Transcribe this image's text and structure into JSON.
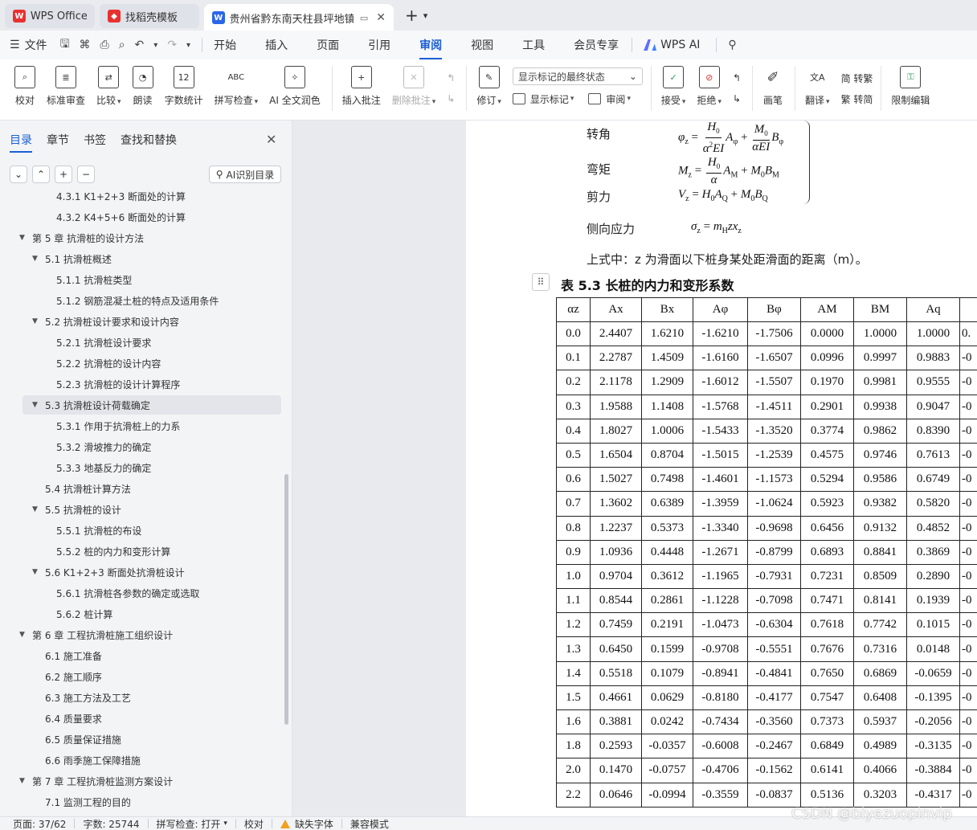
{
  "tabs": [
    {
      "label": "WPS Office",
      "icon": "wps-logo-icon",
      "color": "#e8312f"
    },
    {
      "label": "找稻壳模板",
      "icon": "docer-icon",
      "color": "#e8312f"
    },
    {
      "label": "贵州省黔东南天柱县坪地镇某",
      "icon": "word-doc-icon",
      "color": "#2b66e8"
    }
  ],
  "menubar": {
    "file": "文件",
    "tabs": [
      "开始",
      "插入",
      "页面",
      "引用",
      "审阅",
      "视图",
      "工具",
      "会员专享"
    ],
    "active_tab": "审阅",
    "wps_ai": "WPS AI"
  },
  "ribbon": {
    "proofread": "校对",
    "std_review": "标准审查",
    "compare": "比较",
    "read_aloud": "朗读",
    "word_count": "字数统计",
    "spell_check": "拼写检查",
    "ai_polish": "AI 全文润色",
    "insert_comment": "插入批注",
    "delete_comment": "删除批注",
    "track": "修订",
    "markup_select": "显示标记的最终状态",
    "show_markup": "显示标记",
    "review_pane": "审阅",
    "accept": "接受",
    "reject": "拒绝",
    "pen": "画笔",
    "translate": "翻译",
    "to_traditional": "简 转繁",
    "to_simplified": "繁 转简",
    "restrict_edit": "限制编辑"
  },
  "nav": {
    "tabs": [
      "目录",
      "章节",
      "书签",
      "查找和替换"
    ],
    "active": "目录",
    "ai_button": "AI识别目录",
    "items": [
      {
        "text": "4.3.1 K1+2+3 断面处的计算",
        "level": 3,
        "arrow": ""
      },
      {
        "text": "4.3.2 K4+5+6 断面处的计算",
        "level": 3,
        "arrow": ""
      },
      {
        "text": "第 5 章  抗滑桩的设计方法",
        "level": 1,
        "arrow": "▼"
      },
      {
        "text": "5.1  抗滑桩概述",
        "level": 2,
        "arrow": "▼"
      },
      {
        "text": "5.1.1  抗滑桩类型",
        "level": 3,
        "arrow": ""
      },
      {
        "text": "5.1.2  钢筋混凝土桩的特点及适用条件",
        "level": 3,
        "arrow": ""
      },
      {
        "text": "5.2  抗滑桩设计要求和设计内容",
        "level": 2,
        "arrow": "▼"
      },
      {
        "text": "5.2.1  抗滑桩设计要求",
        "level": 3,
        "arrow": ""
      },
      {
        "text": "5.2.2  抗滑桩的设计内容",
        "level": 3,
        "arrow": ""
      },
      {
        "text": "5.2.3  抗滑桩的设计计算程序",
        "level": 3,
        "arrow": ""
      },
      {
        "text": "5.3  抗滑桩设计荷载确定",
        "level": 2,
        "arrow": "▼",
        "selected": true
      },
      {
        "text": "5.3.1  作用于抗滑桩上的力系",
        "level": 3,
        "arrow": ""
      },
      {
        "text": "5.3.2  滑坡推力的确定",
        "level": 3,
        "arrow": ""
      },
      {
        "text": "5.3.3  地基反力的确定",
        "level": 3,
        "arrow": ""
      },
      {
        "text": "5.4  抗滑桩计算方法",
        "level": 2,
        "arrow": ""
      },
      {
        "text": "5.5  抗滑桩的设计",
        "level": 2,
        "arrow": "▼"
      },
      {
        "text": "5.5.1  抗滑桩的布设",
        "level": 3,
        "arrow": ""
      },
      {
        "text": "5.5.2  桩的内力和变形计算",
        "level": 3,
        "arrow": ""
      },
      {
        "text": "5.6 K1+2+3 断面处抗滑桩设计",
        "level": 2,
        "arrow": "▼"
      },
      {
        "text": "5.6.1  抗滑桩各参数的确定或选取",
        "level": 3,
        "arrow": ""
      },
      {
        "text": "5.6.2  桩计算",
        "level": 3,
        "arrow": ""
      },
      {
        "text": "第 6 章  工程抗滑桩施工组织设计",
        "level": 1,
        "arrow": "▼"
      },
      {
        "text": "6.1  施工准备",
        "level": 2,
        "arrow": ""
      },
      {
        "text": "6.2  施工顺序",
        "level": 2,
        "arrow": ""
      },
      {
        "text": "6.3 施工方法及工艺",
        "level": 2,
        "arrow": ""
      },
      {
        "text": "6.4  质量要求",
        "level": 2,
        "arrow": ""
      },
      {
        "text": "6.5  质量保证措施",
        "level": 2,
        "arrow": ""
      },
      {
        "text": "6.6  雨季施工保障措施",
        "level": 2,
        "arrow": ""
      },
      {
        "text": "第 7 章  工程抗滑桩监测方案设计",
        "level": 1,
        "arrow": "▼"
      },
      {
        "text": "7.1  监测工程的目的",
        "level": 2,
        "arrow": ""
      }
    ]
  },
  "doc": {
    "label_rotation": "转角",
    "label_moment": "弯矩",
    "label_shear": "剪力",
    "label_lateral": "侧向应力",
    "note": "上式中：z 为滑面以下桩身某处距滑面的距离（m）。",
    "table_caption": "表 5.3  长桩的内力和变形系数",
    "table": {
      "headers": [
        "αz",
        "Ax",
        "Bx",
        "Aφ",
        "Bφ",
        "AM",
        "BM",
        "Aq",
        ""
      ],
      "rows": [
        [
          "0.0",
          "2.4407",
          "1.6210",
          "-1.6210",
          "-1.7506",
          "0.0000",
          "1.0000",
          "1.0000",
          "0."
        ],
        [
          "0.1",
          "2.2787",
          "1.4509",
          "-1.6160",
          "-1.6507",
          "0.0996",
          "0.9997",
          "0.9883",
          "-0"
        ],
        [
          "0.2",
          "2.1178",
          "1.2909",
          "-1.6012",
          "-1.5507",
          "0.1970",
          "0.9981",
          "0.9555",
          "-0"
        ],
        [
          "0.3",
          "1.9588",
          "1.1408",
          "-1.5768",
          "-1.4511",
          "0.2901",
          "0.9938",
          "0.9047",
          "-0"
        ],
        [
          "0.4",
          "1.8027",
          "1.0006",
          "-1.5433",
          "-1.3520",
          "0.3774",
          "0.9862",
          "0.8390",
          "-0"
        ],
        [
          "0.5",
          "1.6504",
          "0.8704",
          "-1.5015",
          "-1.2539",
          "0.4575",
          "0.9746",
          "0.7613",
          "-0"
        ],
        [
          "0.6",
          "1.5027",
          "0.7498",
          "-1.4601",
          "-1.1573",
          "0.5294",
          "0.9586",
          "0.6749",
          "-0"
        ],
        [
          "0.7",
          "1.3602",
          "0.6389",
          "-1.3959",
          "-1.0624",
          "0.5923",
          "0.9382",
          "0.5820",
          "-0"
        ],
        [
          "0.8",
          "1.2237",
          "0.5373",
          "-1.3340",
          "-0.9698",
          "0.6456",
          "0.9132",
          "0.4852",
          "-0"
        ],
        [
          "0.9",
          "1.0936",
          "0.4448",
          "-1.2671",
          "-0.8799",
          "0.6893",
          "0.8841",
          "0.3869",
          "-0"
        ],
        [
          "1.0",
          "0.9704",
          "0.3612",
          "-1.1965",
          "-0.7931",
          "0.7231",
          "0.8509",
          "0.2890",
          "-0"
        ],
        [
          "1.1",
          "0.8544",
          "0.2861",
          "-1.1228",
          "-0.7098",
          "0.7471",
          "0.8141",
          "0.1939",
          "-0"
        ],
        [
          "1.2",
          "0.7459",
          "0.2191",
          "-1.0473",
          "-0.6304",
          "0.7618",
          "0.7742",
          "0.1015",
          "-0"
        ],
        [
          "1.3",
          "0.6450",
          "0.1599",
          "-0.9708",
          "-0.5551",
          "0.7676",
          "0.7316",
          "0.0148",
          "-0"
        ],
        [
          "1.4",
          "0.5518",
          "0.1079",
          "-0.8941",
          "-0.4841",
          "0.7650",
          "0.6869",
          "-0.0659",
          "-0"
        ],
        [
          "1.5",
          "0.4661",
          "0.0629",
          "-0.8180",
          "-0.4177",
          "0.7547",
          "0.6408",
          "-0.1395",
          "-0"
        ],
        [
          "1.6",
          "0.3881",
          "0.0242",
          "-0.7434",
          "-0.3560",
          "0.7373",
          "0.5937",
          "-0.2056",
          "-0"
        ],
        [
          "1.8",
          "0.2593",
          "-0.0357",
          "-0.6008",
          "-0.2467",
          "0.6849",
          "0.4989",
          "-0.3135",
          "-0"
        ],
        [
          "2.0",
          "0.1470",
          "-0.0757",
          "-0.4706",
          "-0.1562",
          "0.6141",
          "0.4066",
          "-0.3884",
          "-0"
        ],
        [
          "2.2",
          "0.0646",
          "-0.0994",
          "-0.3559",
          "-0.0837",
          "0.5136",
          "0.3203",
          "-0.4317",
          "-0"
        ]
      ]
    }
  },
  "status": {
    "page": "页面: 37/62",
    "words": "字数: 25744",
    "spell": "拼写检查: 打开",
    "proof": "校对",
    "missing_font": "缺失字体",
    "compat": "兼容模式"
  },
  "watermark": "CSDN @biyezuopinvip"
}
